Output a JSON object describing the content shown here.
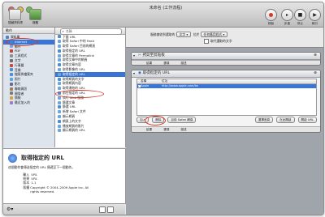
{
  "window": {
    "title": "未命名 (工作流程)"
  },
  "toolbar": {
    "hide_library": "隱藏資料庫",
    "media": "媒體",
    "record": "錄製",
    "step": "步進",
    "stop": "停止",
    "run": "執行"
  },
  "library": {
    "header": "動作",
    "search_placeholder": "名稱",
    "items": [
      "資料庫",
      "Internet",
      "郵件",
      "PDF",
      "工具程式",
      "文字",
      "行事曆",
      "音樂",
      "檔案與檔案夾",
      "照片",
      "影片",
      "聯絡資訊",
      "開發者",
      "簡報",
      "最近加入的"
    ]
  },
  "actions": {
    "header": "名稱",
    "items": [
      "下載 URL",
      "取得 Safari 中的 Feed",
      "取得 Safari 目前的網頁",
      "取得指定的 URL",
      "取得文章的 Permalink",
      "取得文章中的網頁",
      "取得文章內容",
      "取得影像的 URL",
      "取得指定的 URL",
      "取得網頁的文字",
      "取得網頁內容",
      "取得連結的 URL",
      "前往指定的 URL",
      "執行 Web 服務",
      "篩選文章",
      "篩選 URL",
      "新增 Safari 文件",
      "顯示網頁",
      "網頁上的文字",
      "播放網頁的影片",
      "顯示網頁的 URL"
    ]
  },
  "description": {
    "title": "取得指定的 URL",
    "text": "這個動作會傳送指定的 URL 傳遞至下一個動作。",
    "input_label": "輸入",
    "input_value": "URL",
    "result_label": "結果",
    "result_value": "URL",
    "version_label": "版本",
    "version_value": "1.1",
    "copyright_label": "版權",
    "copyright_value": "Copyright © 2004–2009 Apple Inc. All rights reserved."
  },
  "workflow": {
    "receive_label": "服務會收到選取的",
    "receive_value": "文字",
    "in_label": "位於",
    "in_value": "任何應用程式",
    "replace_label": "取代選取的文字",
    "action1": {
      "title": "拷貝至剪貼板",
      "foot": [
        "結果",
        "選項",
        "描述"
      ]
    },
    "action2": {
      "title": "取得指定的 URL",
      "col_name": "名稱",
      "col_address": "位址",
      "row_name": "Apple",
      "row_address": "http://www.apple.com/tw",
      "add_button": "加入",
      "delete_button": "刪除",
      "safari_button": "目前 Safari 網頁",
      "change_button": "選擇首頁",
      "open_button": "在此開啟",
      "view_button": "開啟 URL",
      "foot": [
        "結果",
        "選項",
        "描述"
      ]
    }
  },
  "colors": {
    "selection": "#3875d7",
    "annotation": "#d73a2b"
  }
}
